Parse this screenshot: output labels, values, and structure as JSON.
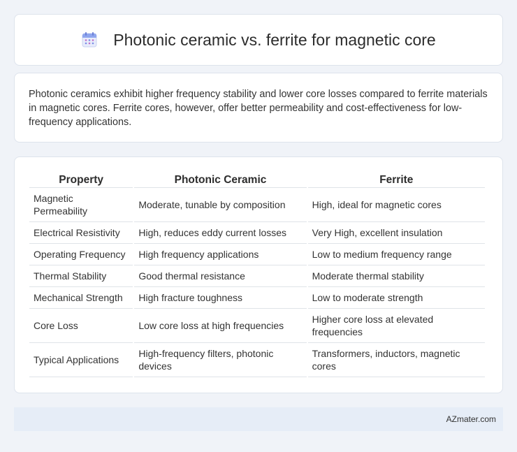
{
  "header": {
    "icon": "calendar-icon",
    "title": "Photonic ceramic vs. ferrite for magnetic core"
  },
  "summary": {
    "text": "Photonic ceramics exhibit higher frequency stability and lower core losses compared to ferrite materials in magnetic cores. Ferrite cores, however, offer better permeability and cost-effectiveness for low-frequency applications."
  },
  "table": {
    "headers": [
      "Property",
      "Photonic Ceramic",
      "Ferrite"
    ],
    "rows": [
      [
        "Magnetic Permeability",
        "Moderate, tunable by composition",
        "High, ideal for magnetic cores"
      ],
      [
        "Electrical Resistivity",
        "High, reduces eddy current losses",
        "Very High, excellent insulation"
      ],
      [
        "Operating Frequency",
        "High frequency applications",
        "Low to medium frequency range"
      ],
      [
        "Thermal Stability",
        "Good thermal resistance",
        "Moderate thermal stability"
      ],
      [
        "Mechanical Strength",
        "High fracture toughness",
        "Low to moderate strength"
      ],
      [
        "Core Loss",
        "Low core loss at high frequencies",
        "Higher core loss at elevated frequencies"
      ],
      [
        "Typical Applications",
        "High-frequency filters, photonic devices",
        "Transformers, inductors, magnetic cores"
      ]
    ]
  },
  "footer": {
    "brand": "AZmater.com"
  },
  "colors": {
    "background": "#f0f3f8",
    "footer_bg": "#e6edf7",
    "icon_accent": "#6b8fe0"
  }
}
